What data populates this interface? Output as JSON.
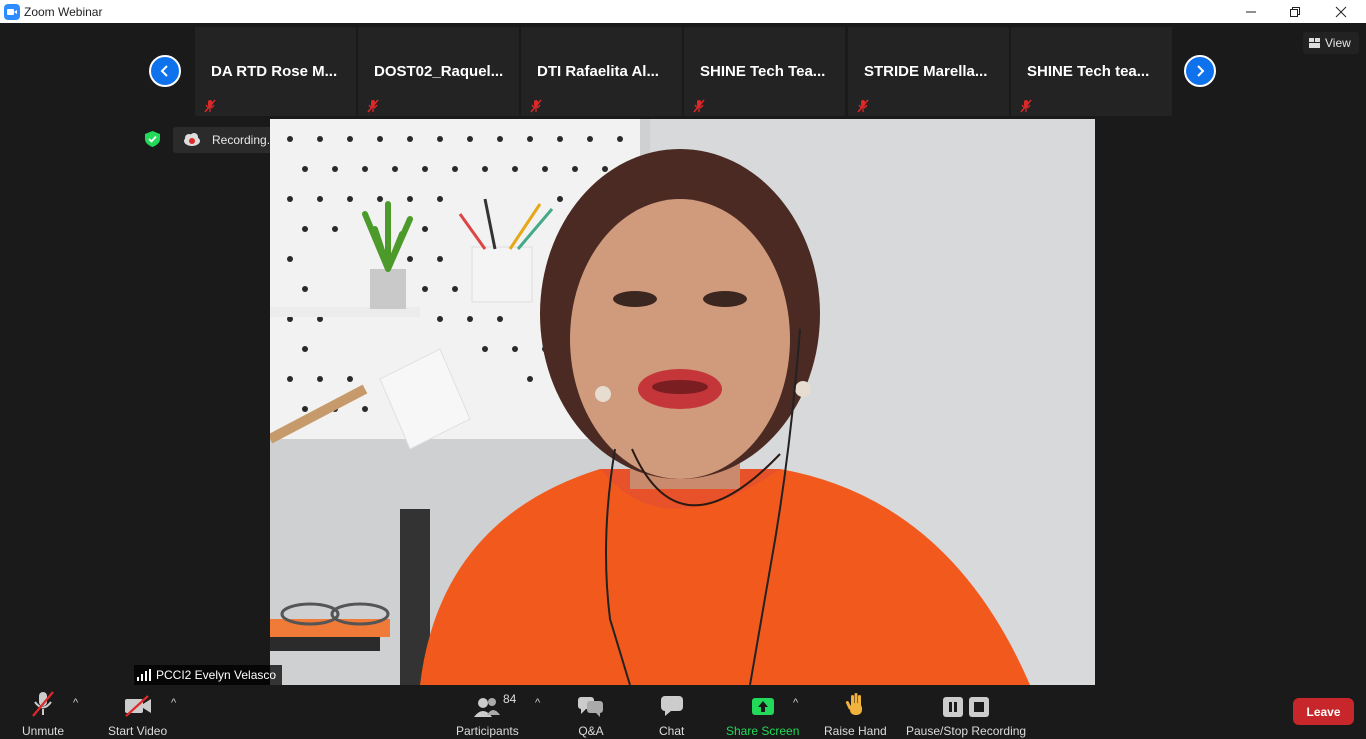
{
  "window": {
    "title": "Zoom Webinar"
  },
  "strip": {
    "tiles": [
      {
        "name": "DA RTD Rose M..."
      },
      {
        "name": "DOST02_Raquel..."
      },
      {
        "name": "DTI Rafaelita Al..."
      },
      {
        "name": "SHINE Tech Tea..."
      },
      {
        "name": "STRIDE  Marella..."
      },
      {
        "name": "SHINE Tech tea..."
      }
    ]
  },
  "view": {
    "label": "View"
  },
  "recording": {
    "label": "Recording..."
  },
  "speaker": {
    "name": "PCCI2 Evelyn Velasco"
  },
  "toolbar": {
    "unmute": "Unmute",
    "start_video": "Start Video",
    "participants": "Participants",
    "participant_count": "84",
    "qa": "Q&A",
    "chat": "Chat",
    "share_screen": "Share Screen",
    "raise_hand": "Raise Hand",
    "pause_stop_recording": "Pause/Stop Recording",
    "leave": "Leave"
  },
  "colors": {
    "accent": "#0e72ed",
    "leave": "#c7262a",
    "share": "#23d959"
  }
}
